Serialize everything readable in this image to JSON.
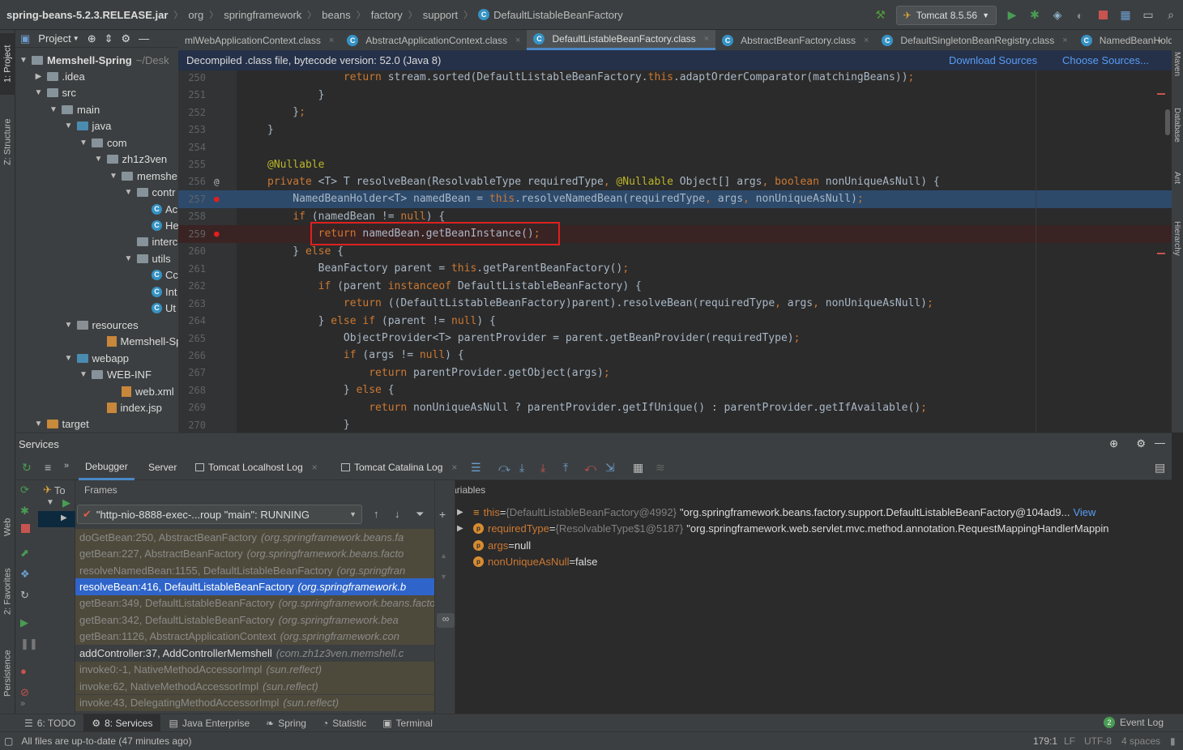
{
  "breadcrumb": {
    "items": [
      "spring-beans-5.2.3.RELEASE.jar",
      "org",
      "springframework",
      "beans",
      "factory",
      "support",
      "DefaultListableBeanFactory"
    ]
  },
  "toolbar": {
    "run_config": "Tomcat 8.5.56"
  },
  "left_strip": {
    "project_tab": "1: Project",
    "structure_tab": "Z: Structure",
    "web_tab": "Web",
    "favorites_tab": "2: Favorites",
    "persistence_tab": "Persistence"
  },
  "right_strip": {
    "maven": "Maven",
    "database": "Database",
    "ant": "Ant",
    "hierarchy": "Hierarchy"
  },
  "project": {
    "header": "Project",
    "tree": [
      {
        "label": "Memshell-Spring",
        "extra": "~/Desk",
        "indent": 0,
        "arrow": "▼",
        "icon": "folder",
        "bold": true
      },
      {
        "label": ".idea",
        "indent": 1,
        "arrow": "▶",
        "icon": "folder"
      },
      {
        "label": "src",
        "indent": 1,
        "arrow": "▼",
        "icon": "folder"
      },
      {
        "label": "main",
        "indent": 2,
        "arrow": "▼",
        "icon": "folder"
      },
      {
        "label": "java",
        "indent": 3,
        "arrow": "▼",
        "icon": "src"
      },
      {
        "label": "com",
        "indent": 4,
        "arrow": "▼",
        "icon": "folder"
      },
      {
        "label": "zh1z3ven",
        "indent": 5,
        "arrow": "▼",
        "icon": "folder"
      },
      {
        "label": "memshe",
        "indent": 6,
        "arrow": "▼",
        "icon": "folder"
      },
      {
        "label": "contr",
        "indent": 7,
        "arrow": "▼",
        "icon": "folder"
      },
      {
        "label": "Ac",
        "indent": 8,
        "arrow": "",
        "icon": "class"
      },
      {
        "label": "He",
        "indent": 8,
        "arrow": "",
        "icon": "class"
      },
      {
        "label": "interc",
        "indent": 7,
        "arrow": "",
        "icon": "folder"
      },
      {
        "label": "utils",
        "indent": 7,
        "arrow": "▼",
        "icon": "folder"
      },
      {
        "label": "Cc",
        "indent": 8,
        "arrow": "",
        "icon": "class"
      },
      {
        "label": "Int",
        "indent": 8,
        "arrow": "",
        "icon": "class"
      },
      {
        "label": "Ut",
        "indent": 8,
        "arrow": "",
        "icon": "class"
      },
      {
        "label": "resources",
        "indent": 3,
        "arrow": "▼",
        "icon": "res"
      },
      {
        "label": "Memshell-Spr",
        "indent": 5,
        "arrow": "",
        "icon": "file"
      },
      {
        "label": "webapp",
        "indent": 3,
        "arrow": "▼",
        "icon": "src"
      },
      {
        "label": "WEB-INF",
        "indent": 4,
        "arrow": "▼",
        "icon": "folder"
      },
      {
        "label": "web.xml",
        "indent": 6,
        "arrow": "",
        "icon": "file"
      },
      {
        "label": "index.jsp",
        "indent": 5,
        "arrow": "",
        "icon": "file"
      },
      {
        "label": "target",
        "indent": 1,
        "arrow": "▼",
        "icon": "tgt"
      }
    ]
  },
  "editor_tabs": [
    {
      "label": "mlWebApplicationContext.class",
      "active": false
    },
    {
      "label": "AbstractApplicationContext.class",
      "active": false
    },
    {
      "label": "DefaultListableBeanFactory.class",
      "active": true
    },
    {
      "label": "AbstractBeanFactory.class",
      "active": false
    },
    {
      "label": "DefaultSingletonBeanRegistry.class",
      "active": false
    },
    {
      "label": "NamedBeanHolder.cla",
      "active": false
    }
  ],
  "banner": {
    "text": "Decompiled .class file, bytecode version: 52.0 (Java 8)",
    "download": "Download Sources",
    "choose": "Choose Sources..."
  },
  "code_lines": [
    {
      "n": "250",
      "mark": "",
      "style": "",
      "html": "            <span class='k'>return</span> stream.sorted(DefaultListableBeanFactory.<span class='k'>this</span>.adaptOrderComparator(matchingBeans))<span class='k'>;</span>"
    },
    {
      "n": "251",
      "mark": "",
      "style": "",
      "html": "        }"
    },
    {
      "n": "252",
      "mark": "",
      "style": "",
      "html": "    }<span class='k'>;</span>"
    },
    {
      "n": "253",
      "mark": "",
      "style": "",
      "html": "}"
    },
    {
      "n": "254",
      "mark": "",
      "style": "",
      "html": ""
    },
    {
      "n": "255",
      "mark": "",
      "style": "",
      "html": "<span class='a'>@Nullable</span>"
    },
    {
      "n": "256",
      "mark": "@",
      "style": "",
      "html": "<span class='k'>private</span> &lt;T&gt; T resolveBean(ResolvableType requiredType<span class='k'>,</span> <span class='a'>@Nullable</span> Object[] args<span class='k'>,</span> <span class='k'>boolean</span> nonUniqueAsNull) {"
    },
    {
      "n": "257",
      "mark": "bp",
      "style": "exec",
      "html": "    NamedBeanHolder&lt;T&gt; namedBean = <span class='k'>this</span>.resolveNamedBean(requiredType<span class='k'>,</span> args<span class='k'>,</span> nonUniqueAsNull)<span class='k'>;</span>"
    },
    {
      "n": "258",
      "mark": "",
      "style": "",
      "html": "    <span class='k'>if</span> (namedBean != <span class='k'>null</span>) {"
    },
    {
      "n": "259",
      "mark": "bp",
      "style": "bp",
      "html": "        <span class='k'>return</span> namedBean.getBeanInstance()<span class='k'>;</span>"
    },
    {
      "n": "260",
      "mark": "",
      "style": "",
      "html": "    } <span class='k'>else</span> {"
    },
    {
      "n": "261",
      "mark": "",
      "style": "",
      "html": "        BeanFactory parent = <span class='k'>this</span>.getParentBeanFactory()<span class='k'>;</span>"
    },
    {
      "n": "262",
      "mark": "",
      "style": "",
      "html": "        <span class='k'>if</span> (parent <span class='k'>instanceof</span> DefaultListableBeanFactory) {"
    },
    {
      "n": "263",
      "mark": "",
      "style": "",
      "html": "            <span class='k'>return</span> ((DefaultListableBeanFactory)parent).resolveBean(requiredType<span class='k'>,</span> args<span class='k'>,</span> nonUniqueAsNull)<span class='k'>;</span>"
    },
    {
      "n": "264",
      "mark": "",
      "style": "",
      "html": "        } <span class='k'>else if</span> (parent != <span class='k'>null</span>) {"
    },
    {
      "n": "265",
      "mark": "",
      "style": "",
      "html": "            ObjectProvider&lt;T&gt; parentProvider = parent.getBeanProvider(requiredType)<span class='k'>;</span>"
    },
    {
      "n": "266",
      "mark": "",
      "style": "",
      "html": "            <span class='k'>if</span> (args != <span class='k'>null</span>) {"
    },
    {
      "n": "267",
      "mark": "",
      "style": "",
      "html": "                <span class='k'>return</span> parentProvider.getObject(args)<span class='k'>;</span>"
    },
    {
      "n": "268",
      "mark": "",
      "style": "",
      "html": "            } <span class='k'>else</span> {"
    },
    {
      "n": "269",
      "mark": "",
      "style": "",
      "html": "                <span class='k'>return</span> nonUniqueAsNull ? parentProvider.getIfUnique() : parentProvider.getIfAvailable()<span class='k'>;</span>"
    },
    {
      "n": "270",
      "mark": "",
      "style": "",
      "html": "            }"
    }
  ],
  "services": {
    "title": "Services",
    "tabs": [
      "Debugger",
      "Server",
      "Tomcat Localhost Log",
      "Tomcat Catalina Log"
    ],
    "tree_label": "To",
    "frames_label": "Frames",
    "variables_label": "Variables",
    "thread": "\"http-nio-8888-exec-...roup \"main\": RUNNING",
    "frames": [
      {
        "m": "doGetBean:250, AbstractBeanFactory",
        "p": "(org.springframework.beans.fa",
        "kind": "lib"
      },
      {
        "m": "getBean:227, AbstractBeanFactory",
        "p": "(org.springframework.beans.facto",
        "kind": "lib"
      },
      {
        "m": "resolveNamedBean:1155, DefaultListableBeanFactory",
        "p": "(org.springfran",
        "kind": "lib"
      },
      {
        "m": "resolveBean:416, DefaultListableBeanFactory",
        "p": "(org.springframework.b",
        "kind": "sel"
      },
      {
        "m": "getBean:349, DefaultListableBeanFactory",
        "p": "(org.springframework.beans.factory.support)",
        "kind": "lib"
      },
      {
        "m": "getBean:342, DefaultListableBeanFactory",
        "p": "(org.springframework.bea",
        "kind": "lib"
      },
      {
        "m": "getBean:1126, AbstractApplicationContext",
        "p": "(org.springframework.con",
        "kind": "lib"
      },
      {
        "m": "addController:37, AddControllerMemshell",
        "p": "(com.zh1z3ven.memshell.c",
        "kind": "usr"
      },
      {
        "m": "invoke0:-1, NativeMethodAccessorImpl",
        "p": "(sun.reflect)",
        "kind": "lib"
      },
      {
        "m": "invoke:62, NativeMethodAccessorImpl",
        "p": "(sun.reflect)",
        "kind": "lib"
      },
      {
        "m": "invoke:43, DelegatingMethodAccessorImpl",
        "p": "(sun.reflect)",
        "kind": "lib"
      }
    ],
    "variables": [
      {
        "name": "this",
        "type": "{DefaultListableBeanFactory@4992}",
        "value": "\"org.springframework.beans.factory.support.DefaultListableBeanFactory@104ad9...",
        "link": "View",
        "arrow": "▶",
        "icon": "eq"
      },
      {
        "name": "requiredType",
        "type": "{ResolvableType$1@5187}",
        "value": "\"org.springframework.web.servlet.mvc.method.annotation.RequestMappingHandlerMappin",
        "link": "",
        "arrow": "▶",
        "icon": "p"
      },
      {
        "name": "args",
        "type": "",
        "value": "null",
        "link": "",
        "arrow": "",
        "icon": "p"
      },
      {
        "name": "nonUniqueAsNull",
        "type": "",
        "value": "false",
        "link": "",
        "arrow": "",
        "icon": "p"
      }
    ]
  },
  "bottom_tabs": [
    {
      "label": "6: TODO",
      "icon": "☰",
      "active": false
    },
    {
      "label": "8: Services",
      "icon": "⚙",
      "active": true
    },
    {
      "label": "Java Enterprise",
      "icon": "▤",
      "active": false
    },
    {
      "label": "Spring",
      "icon": "❧",
      "active": false
    },
    {
      "label": "Statistic",
      "icon": "◔",
      "active": false
    },
    {
      "label": "Terminal",
      "icon": "▣",
      "active": false
    }
  ],
  "event_log": {
    "count": "2",
    "label": "Event Log"
  },
  "status": {
    "message": "All files are up-to-date (47 minutes ago)",
    "position": "179:1",
    "line_sep": "LF",
    "encoding": "UTF-8",
    "indent": "4 spaces"
  },
  "colors": {
    "accent": "#4a88c7",
    "breakpoint": "#e0201f",
    "selection": "#2f65ca"
  }
}
